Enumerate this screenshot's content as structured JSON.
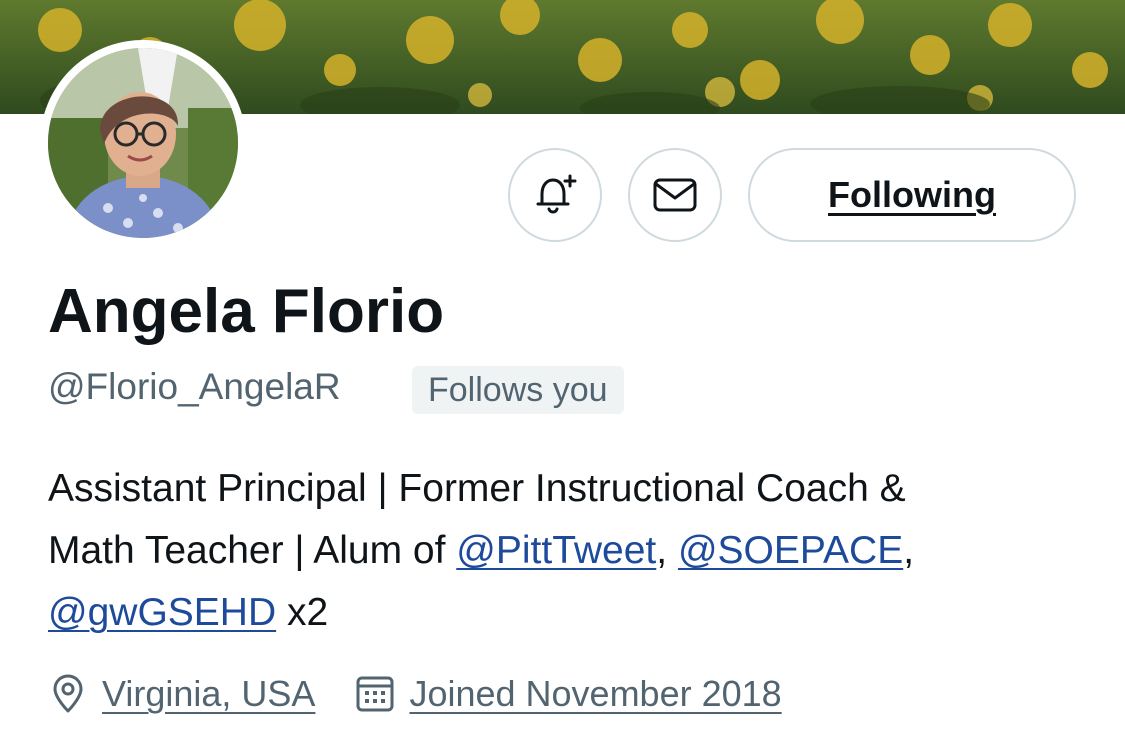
{
  "profile": {
    "display_name": "Angela Florio",
    "handle": "@Florio_AngelaR",
    "follows_you_badge": "Follows you"
  },
  "actions": {
    "notify_icon": "bell-plus-icon",
    "message_icon": "envelope-icon",
    "following_label": "Following"
  },
  "bio": {
    "line1": "Assistant Principal | Former Instructional Coach &",
    "line2_prefix": "Math Teacher | Alum of ",
    "mention1": "@PittTweet",
    "sep1": ", ",
    "mention2": "@SOEPACE",
    "sep2": ",",
    "mention3": "@gwGSEHD",
    "line3_suffix": " x2"
  },
  "meta": {
    "location_icon": "location-pin-icon",
    "location": "Virginia, USA",
    "joined_icon": "calendar-icon",
    "joined": "Joined November 2018"
  },
  "colors": {
    "text_primary": "#0f1419",
    "text_secondary": "#536471",
    "mention": "#1d4a9b",
    "border": "#cfd9de",
    "badge_bg": "#eff3f4"
  }
}
